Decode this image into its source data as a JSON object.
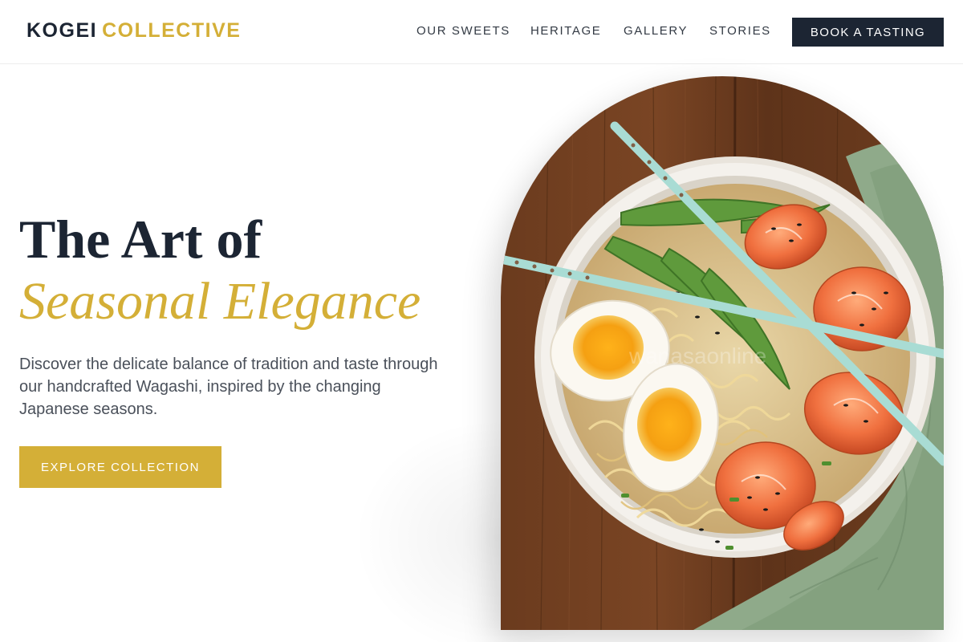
{
  "brand": {
    "part1": "KOGEI",
    "part2": "COLLECTIVE"
  },
  "nav": {
    "items": [
      "OUR SWEETS",
      "HERITAGE",
      "GALLERY",
      "STORIES"
    ],
    "cta": "BOOK A TASTING"
  },
  "hero": {
    "title": "The Art of",
    "subtitle": "Seasonal Elegance",
    "description": "Discover the delicate balance of tradition and taste through our handcrafted Wagashi, inspired by the changing Japanese seasons.",
    "button": "EXPLORE COLLECTION",
    "watermark": "wanasaonline"
  },
  "colors": {
    "navy": "#1c2533",
    "gold": "#d4af37",
    "text_gray": "#4a505a"
  }
}
